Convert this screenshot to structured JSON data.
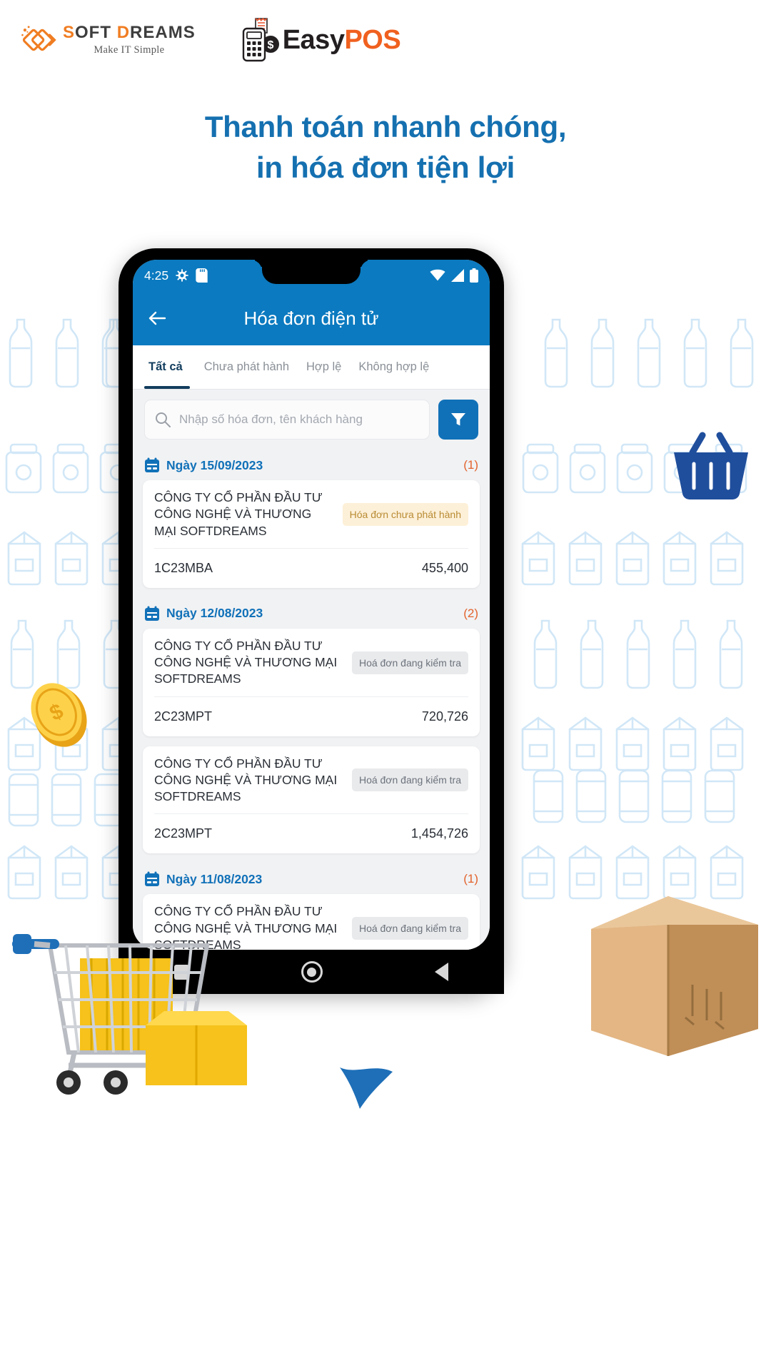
{
  "brand": {
    "softdreams": {
      "word1": "S",
      "word1_rest": "OFT",
      "word2": "D",
      "word2_rest": "REAMS",
      "tagline": "Make IT Simple",
      "mark_icon": "softdreams-diamond-icon"
    },
    "easypos": {
      "easy": "Easy",
      "pos": "POS",
      "mark_icon": "pos-terminal-icon"
    }
  },
  "headline": {
    "line1": "Thanh toán nhanh chóng,",
    "line2": "in hóa đơn tiện lợi",
    "color": "#1570b0"
  },
  "phone": {
    "statusbar": {
      "time": "4:25",
      "icons": [
        "android-debug-icon",
        "sd-card-icon",
        "wifi-icon",
        "signal-icon",
        "battery-icon"
      ]
    },
    "appbar": {
      "back_icon": "back-arrow-icon",
      "title": "Hóa đơn điện tử",
      "bg": "#0b7ac0"
    },
    "tabs": [
      {
        "label": "Tất cả",
        "active": true
      },
      {
        "label": "Chưa phát hành",
        "active": false
      },
      {
        "label": "Hợp lệ",
        "active": false
      },
      {
        "label": "Không hợp lệ",
        "active": false
      }
    ],
    "search": {
      "placeholder": "Nhập số hóa đơn, tên khách hàng",
      "value": "",
      "icon": "search-icon",
      "filter_icon": "filter-funnel-icon"
    },
    "groups": [
      {
        "date_icon": "calendar-icon",
        "date_label": "Ngày 15/09/2023",
        "count": "(1)",
        "invoices": [
          {
            "customer": "CÔNG TY CỔ PHẦN ĐẦU TƯ CÔNG NGHỆ VÀ THƯƠNG MẠI SOFTDREAMS",
            "status": "Hóa đơn chưa phát hành",
            "status_type": "warn",
            "code": "1C23MBA",
            "amount": "455,400"
          }
        ]
      },
      {
        "date_icon": "calendar-icon",
        "date_label": "Ngày 12/08/2023",
        "count": "(2)",
        "invoices": [
          {
            "customer": "CÔNG TY CỔ PHẦN ĐẦU TƯ CÔNG NGHỆ VÀ THƯƠNG MẠI SOFTDREAMS",
            "status": "Hoá đơn đang kiểm tra",
            "status_type": "gray",
            "code": "2C23MPT",
            "amount": "720,726"
          },
          {
            "customer": "CÔNG TY CỔ PHẦN ĐẦU TƯ CÔNG NGHỆ VÀ THƯƠNG MẠI SOFTDREAMS",
            "status": "Hoá đơn đang kiểm tra",
            "status_type": "gray",
            "code": "2C23MPT",
            "amount": "1,454,726"
          }
        ]
      },
      {
        "date_icon": "calendar-icon",
        "date_label": "Ngày 11/08/2023",
        "count": "(1)",
        "invoices": [
          {
            "customer": "CÔNG TY CỔ PHẦN ĐẦU TƯ CÔNG NGHỆ VÀ THƯƠNG MẠI SOFTDREAMS",
            "status": "Hoá đơn đang kiểm tra",
            "status_type": "gray",
            "code": "",
            "amount": ""
          }
        ]
      }
    ],
    "navbar": {
      "recents_icon": "square-recents-icon",
      "home_icon": "circle-home-icon",
      "back_icon": "triangle-back-icon"
    }
  },
  "decorations": [
    "coin-icon",
    "shopping-basket-icon",
    "shopping-cart-icon",
    "cardboard-box-icon",
    "blue-flag-icon"
  ],
  "colors": {
    "primary": "#0b7ac0",
    "accent_orange": "#f0601f",
    "headline_blue": "#1570b0",
    "count_orange": "#e2632c"
  }
}
